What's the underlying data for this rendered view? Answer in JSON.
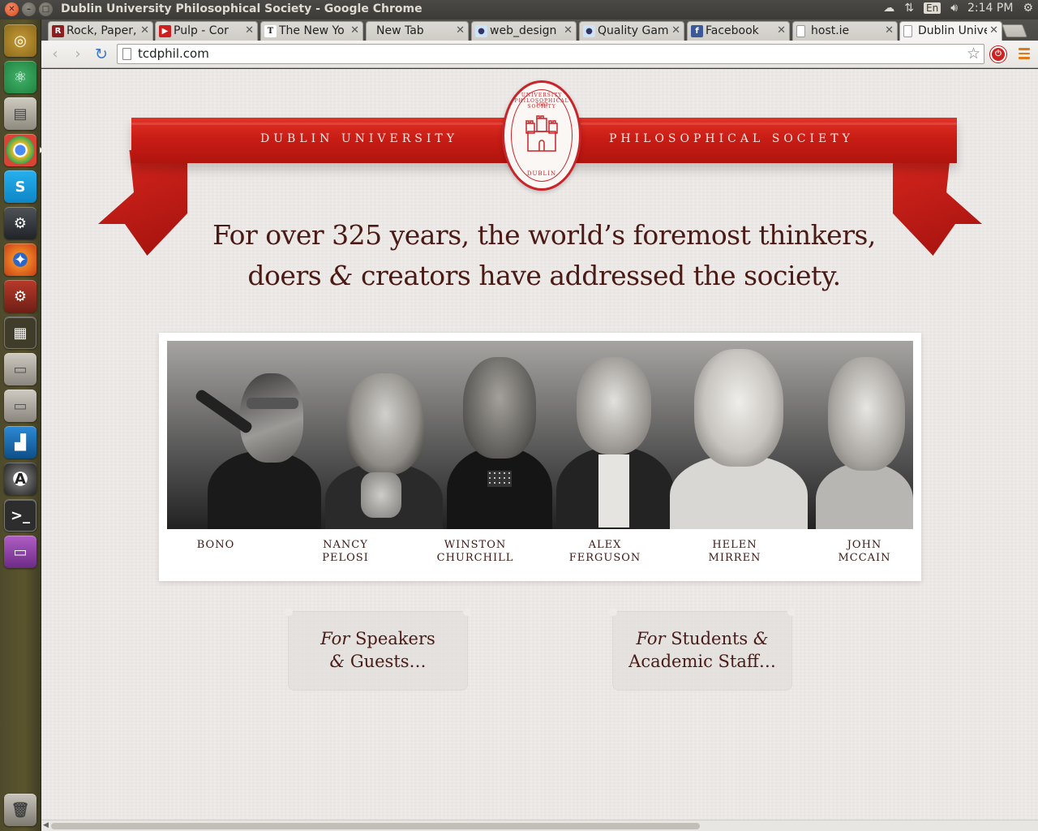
{
  "os": {
    "window_title": "Dublin University Philosophical Society - Google Chrome",
    "lang": "En",
    "clock": "2:14 PM"
  },
  "tabs": [
    {
      "label": "Rock, Paper,",
      "favicon": "rps-icon",
      "color": "#8b1e1e"
    },
    {
      "label": "Pulp - Cor",
      "favicon": "youtube-icon",
      "color": "#cc1f1f"
    },
    {
      "label": "The New Yo",
      "favicon": "nyt-icon",
      "color": "#222222"
    },
    {
      "label": "New Tab",
      "favicon": "",
      "color": ""
    },
    {
      "label": "web_design",
      "favicon": "reddit-icon",
      "color": "#5f99cf"
    },
    {
      "label": "Quality Gam",
      "favicon": "reddit-icon",
      "color": "#5f99cf"
    },
    {
      "label": "Facebook",
      "favicon": "facebook-icon",
      "color": "#3b5998"
    },
    {
      "label": "host.ie",
      "favicon": "page-icon",
      "color": "#999999"
    },
    {
      "label": "Dublin Unive",
      "favicon": "page-icon",
      "color": "#999999"
    }
  ],
  "browser": {
    "url": "tcdphil.com"
  },
  "page": {
    "ribbon_left": "DUBLIN UNIVERSITY",
    "ribbon_right": "PHILOSOPHICAL SOCIETY",
    "seal_top": "UNIVERSITY PHILOSOPHICAL SOCIETY",
    "seal_year": "1683",
    "seal_bottom": "DUBLIN",
    "headline_line1": "For over 325 years, the world’s foremost thinkers,",
    "headline_line2a": "doers",
    "headline_amp": "&",
    "headline_line2b": "creators have addressed the society.",
    "speakers": [
      {
        "line1": "BONO",
        "line2": ""
      },
      {
        "line1": "NANCY",
        "line2": "PELOSI"
      },
      {
        "line1": "WINSTON",
        "line2": "CHURCHILL"
      },
      {
        "line1": "ALEX",
        "line2": "FERGUSON"
      },
      {
        "line1": "HELEN",
        "line2": "MIRREN"
      },
      {
        "line1": "JOHN",
        "line2": "MCCAIN"
      }
    ],
    "tickets": [
      {
        "it1": "For",
        "rest1": " Speakers",
        "it2": "&",
        "rest2": " Guests…"
      },
      {
        "it1": "For",
        "rest1": " Students ",
        "amp": "&",
        "line2": "Academic Staff…"
      }
    ]
  }
}
